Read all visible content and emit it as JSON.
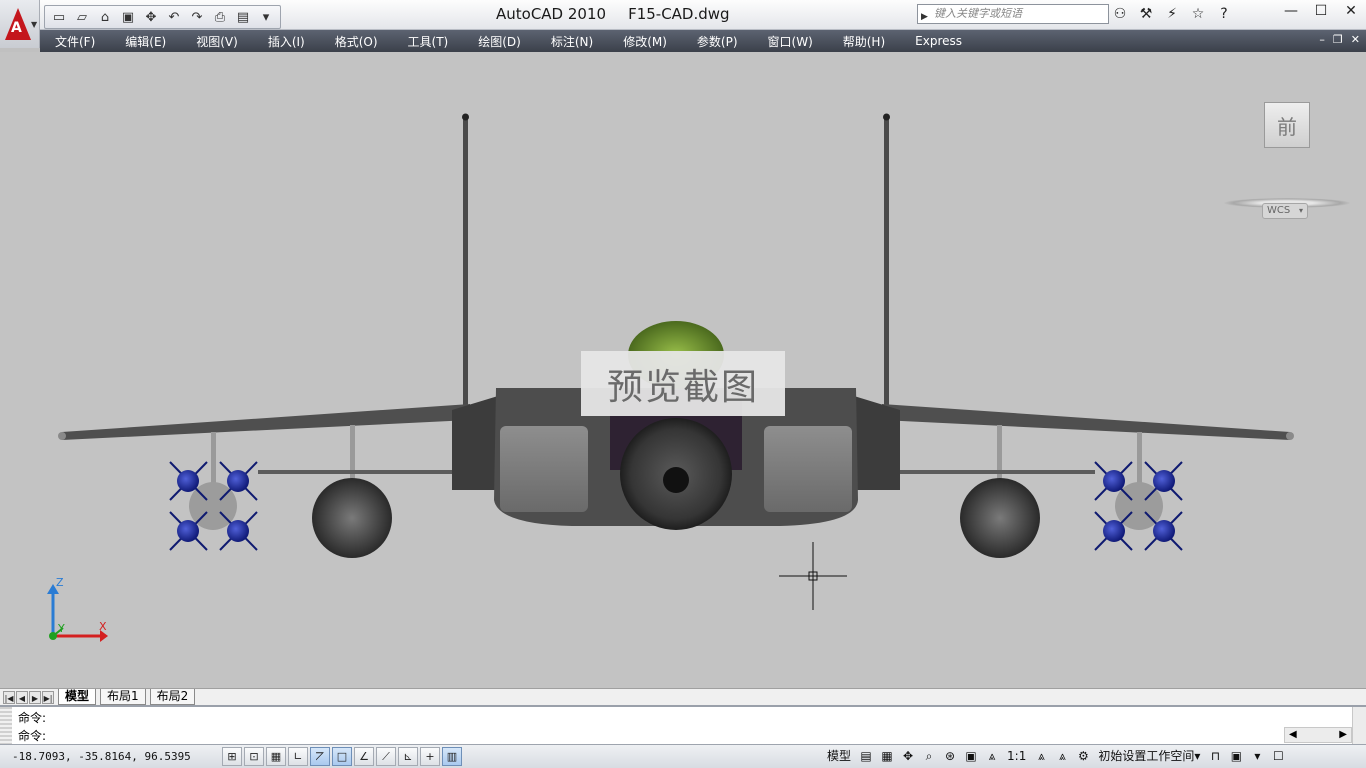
{
  "app": {
    "name": "AutoCAD 2010",
    "file": "F15-CAD.dwg",
    "logo_letter": "A"
  },
  "quick_access": [
    {
      "name": "new",
      "glyph": "▭"
    },
    {
      "name": "open",
      "glyph": "▱"
    },
    {
      "name": "save-as",
      "glyph": "⌂"
    },
    {
      "name": "save",
      "glyph": "▣"
    },
    {
      "name": "pan",
      "glyph": "✥"
    },
    {
      "name": "undo",
      "glyph": "↶"
    },
    {
      "name": "redo",
      "glyph": "↷"
    },
    {
      "name": "plot",
      "glyph": "⎙"
    },
    {
      "name": "preview",
      "glyph": "▤"
    },
    {
      "name": "customize",
      "glyph": "▾"
    }
  ],
  "search": {
    "placeholder": "键入关键字或短语"
  },
  "info_tools": [
    {
      "name": "binoculars",
      "glyph": "⚇"
    },
    {
      "name": "wrench",
      "glyph": "⚒"
    },
    {
      "name": "satellite",
      "glyph": "⚡"
    },
    {
      "name": "favorites",
      "glyph": "☆"
    },
    {
      "name": "help",
      "glyph": "?"
    }
  ],
  "window_controls": {
    "minimize": "—",
    "maximize": "☐",
    "close": "✕"
  },
  "menu": [
    "文件(F)",
    "编辑(E)",
    "视图(V)",
    "插入(I)",
    "格式(O)",
    "工具(T)",
    "绘图(D)",
    "标注(N)",
    "修改(M)",
    "参数(P)",
    "窗口(W)",
    "帮助(H)",
    "Express"
  ],
  "mdi_controls": {
    "minimize": "–",
    "restore": "❐",
    "close": "✕"
  },
  "viewcube": {
    "face": "前"
  },
  "wcs": {
    "label": "WCS",
    "caret": "▾"
  },
  "ucs": {
    "x": "X",
    "y": "Y",
    "z": "Z"
  },
  "watermark": "预览截图",
  "layout_tabs": {
    "nav": [
      "|◀",
      "◀",
      "▶",
      "▶|"
    ],
    "tabs": [
      "模型",
      "布局1",
      "布局2"
    ],
    "active": 0
  },
  "command": {
    "history": "命令:",
    "prompt": "命令:"
  },
  "status": {
    "coordinates": "-18.7093, -35.8164, 96.5395",
    "toggles": [
      {
        "name": "infer",
        "glyph": "⊞",
        "on": false
      },
      {
        "name": "snap",
        "glyph": "⊡",
        "on": false
      },
      {
        "name": "grid",
        "glyph": "▦",
        "on": false
      },
      {
        "name": "ortho",
        "glyph": "∟",
        "on": false
      },
      {
        "name": "polar",
        "glyph": "⦢",
        "on": true
      },
      {
        "name": "osnap",
        "glyph": "□",
        "on": true
      },
      {
        "name": "3dosnap",
        "glyph": "∠",
        "on": false
      },
      {
        "name": "otrack",
        "glyph": "⟋",
        "on": false
      },
      {
        "name": "ducs",
        "glyph": "⊾",
        "on": false
      },
      {
        "name": "dyn",
        "glyph": "+",
        "on": false
      },
      {
        "name": "lwt",
        "glyph": "▥",
        "on": true
      }
    ],
    "model_label": "模型",
    "scale": "1:1",
    "workspace": "初始设置工作空间",
    "workspace_caret": "▾"
  }
}
